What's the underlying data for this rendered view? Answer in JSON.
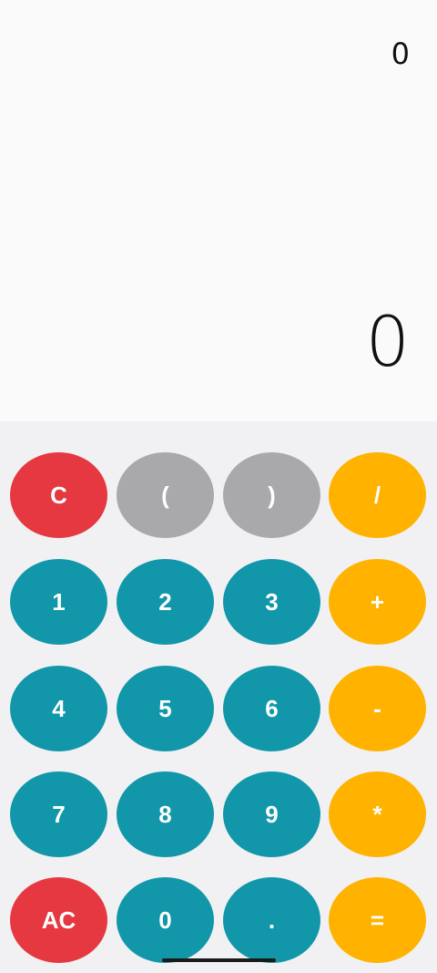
{
  "display": {
    "expression": "0",
    "result": "0"
  },
  "keys": {
    "row1": [
      "C",
      "(",
      ")",
      "/"
    ],
    "row2": [
      "1",
      "2",
      "3",
      "+"
    ],
    "row3": [
      "4",
      "5",
      "6",
      "-"
    ],
    "row4": [
      "7",
      "8",
      "9",
      "*"
    ],
    "row5": [
      "AC",
      "0",
      ".",
      "="
    ]
  },
  "colors": {
    "clear": "#e53840",
    "paren": "#a9a9ab",
    "digit": "#1197a9",
    "operator": "#ffb300"
  }
}
